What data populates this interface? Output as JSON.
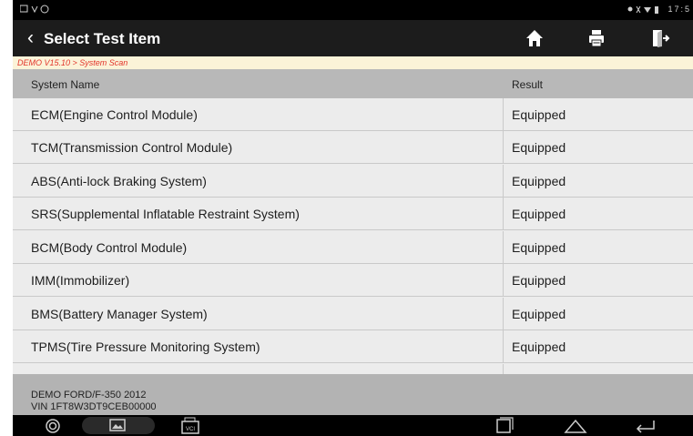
{
  "status_bar": {
    "left_icons": [
      "notification-icon",
      "usb-icon",
      "app-icon"
    ],
    "time": "17:5"
  },
  "header": {
    "title": "Select Test Item"
  },
  "breadcrumb": "DEMO V15.10 > System Scan",
  "table": {
    "columns": [
      "System Name",
      "Result"
    ],
    "rows": [
      {
        "name": "ECM(Engine Control Module)",
        "result": "Equipped"
      },
      {
        "name": "TCM(Transmission Control Module)",
        "result": "Equipped"
      },
      {
        "name": "ABS(Anti-lock Braking System)",
        "result": "Equipped"
      },
      {
        "name": "SRS(Supplemental Inflatable Restraint System)",
        "result": "Equipped"
      },
      {
        "name": "BCM(Body Control Module)",
        "result": "Equipped"
      },
      {
        "name": "IMM(Immobilizer)",
        "result": "Equipped"
      },
      {
        "name": "BMS(Battery Manager System)",
        "result": "Equipped"
      },
      {
        "name": "TPMS(Tire Pressure Monitoring System)",
        "result": "Equipped"
      },
      {
        "name": "",
        "result": ""
      }
    ]
  },
  "footer": {
    "vehicle": "DEMO FORD/F-350 2012",
    "vin": "VIN 1FT8W3DT9CEB00000"
  },
  "navbar": {
    "vci_label": "VCI"
  },
  "colors": {
    "titlebar": "#1c1c1c",
    "breadcrumb_text": "#e2342a",
    "header_row": "#b8b8b8",
    "row_bg": "#ececec"
  }
}
